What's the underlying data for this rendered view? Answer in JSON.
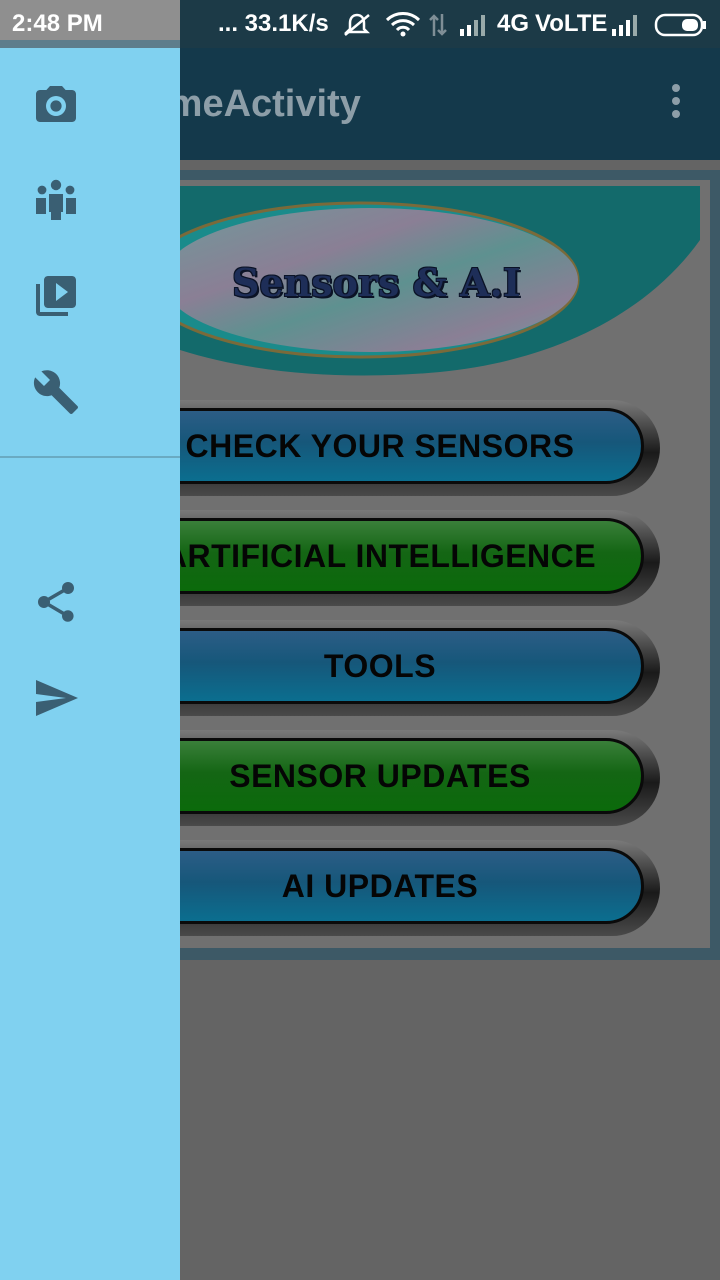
{
  "status_bar": {
    "time": "2:48 PM",
    "net_speed": "... 33.1K/s",
    "network": "4G",
    "volte": "VoLTE"
  },
  "app_bar": {
    "title": "HomeActivity",
    "overflow_icon": "more-vert-icon"
  },
  "banner": {
    "title": "Sensors & A.I"
  },
  "buttons": [
    {
      "label": "CHECK YOUR SENSORS",
      "color": "blue"
    },
    {
      "label": "ARTIFICIAL INTELLIGENCE",
      "color": "green"
    },
    {
      "label": "TOOLS",
      "color": "blue"
    },
    {
      "label": "SENSOR UPDATES",
      "color": "green"
    },
    {
      "label": "AI UPDATES",
      "color": "blue"
    }
  ],
  "drawer": {
    "background": "#80d1f0",
    "items_top": [
      "camera-icon",
      "group-icon",
      "video-library-icon",
      "wrench-icon"
    ],
    "items_bottom": [
      "share-icon",
      "send-icon"
    ]
  },
  "colors": {
    "appbar": "#14394b",
    "scrim": "#646464",
    "button_blue": "#16577a",
    "button_green": "#146614"
  }
}
